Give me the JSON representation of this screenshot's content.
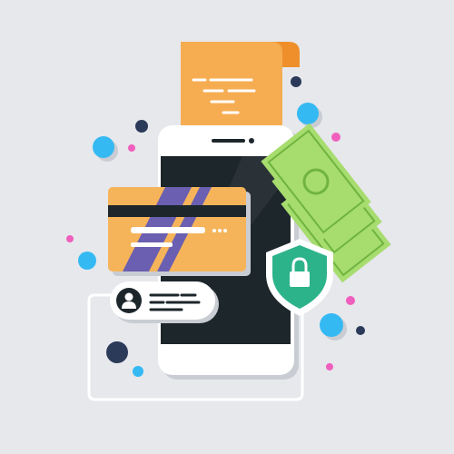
{
  "colors": {
    "background": "#e6e8ec",
    "phone_body": "#ffffff",
    "phone_screen": "#1d262b",
    "receipt": "#f6ad52",
    "receipt_fold": "#ef8f2b",
    "card": "#f6b45a",
    "card_stripe": "#6a5fb0",
    "card_magstripe": "#1d262b",
    "cash": "#a7dc6f",
    "cash_dark": "#6fb43f",
    "shield": "#2db38a",
    "shield_outline": "#ffffff",
    "chat_bubble": "#ffffff",
    "avatar": "#1d262b",
    "accent_blue": "#35b9f2",
    "accent_pink": "#f05fbd",
    "accent_navy": "#2c3a59",
    "connector_line": "#ffffff",
    "shadow": "#c9cdd3"
  },
  "icons": {
    "phone": "smartphone-icon",
    "receipt": "receipt-icon",
    "card": "credit-card-icon",
    "cash": "banknotes-icon",
    "shield": "security-shield-icon",
    "lock": "padlock-icon",
    "avatar": "user-avatar-icon"
  }
}
